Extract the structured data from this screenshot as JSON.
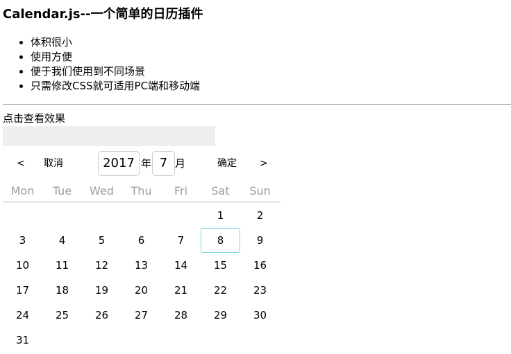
{
  "title": "Calendar.js--一个简单的日历插件",
  "features": [
    "体积很小",
    "使用方便",
    "便于我们使用到不同场景",
    "只需修改CSS就可适用PC端和移动端"
  ],
  "trigger": {
    "label": "点击查看效果",
    "value": ""
  },
  "calendar": {
    "prev": "<",
    "cancel": "取消",
    "year": "2017",
    "year_suffix": "年",
    "month": "7",
    "month_suffix": "月",
    "confirm": "确定",
    "next": ">",
    "weekdays": [
      "Mon",
      "Tue",
      "Wed",
      "Thu",
      "Fri",
      "Sat",
      "Sun"
    ],
    "first_weekday_index": 5,
    "days_in_month": 31,
    "days": [
      "1",
      "2",
      "3",
      "4",
      "5",
      "6",
      "7",
      "8",
      "9",
      "10",
      "11",
      "12",
      "13",
      "14",
      "15",
      "16",
      "17",
      "18",
      "19",
      "20",
      "21",
      "22",
      "23",
      "24",
      "25",
      "26",
      "27",
      "28",
      "29",
      "30",
      "31"
    ],
    "selected_day": "8",
    "selected_color": "#7fd6dc",
    "weekday_color": "#9c9c9c"
  }
}
